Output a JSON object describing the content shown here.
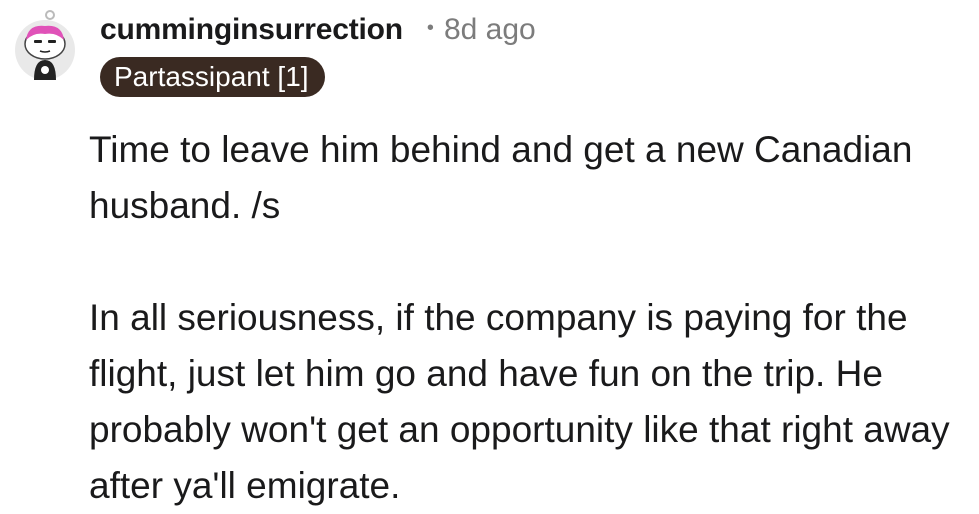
{
  "comment": {
    "username": "cumminginsurrection",
    "separator": "•",
    "time_ago": "8d ago",
    "flair": "Partassipant [1]",
    "paragraphs": [
      "Time to leave him behind and get a new Canadian husband. /s",
      "In all seriousness, if the company is paying for the flight, just let him go and have fun on the trip. He probably won't get an opportunity like that right away after ya'll emigrate."
    ],
    "avatar_icon": "snoo-avatar-icon"
  },
  "colors": {
    "flair_background": "#3a2a22",
    "muted_text": "#7c7c7c",
    "body_text": "#1a1a1b",
    "avatar_hair": "#e052b8"
  }
}
